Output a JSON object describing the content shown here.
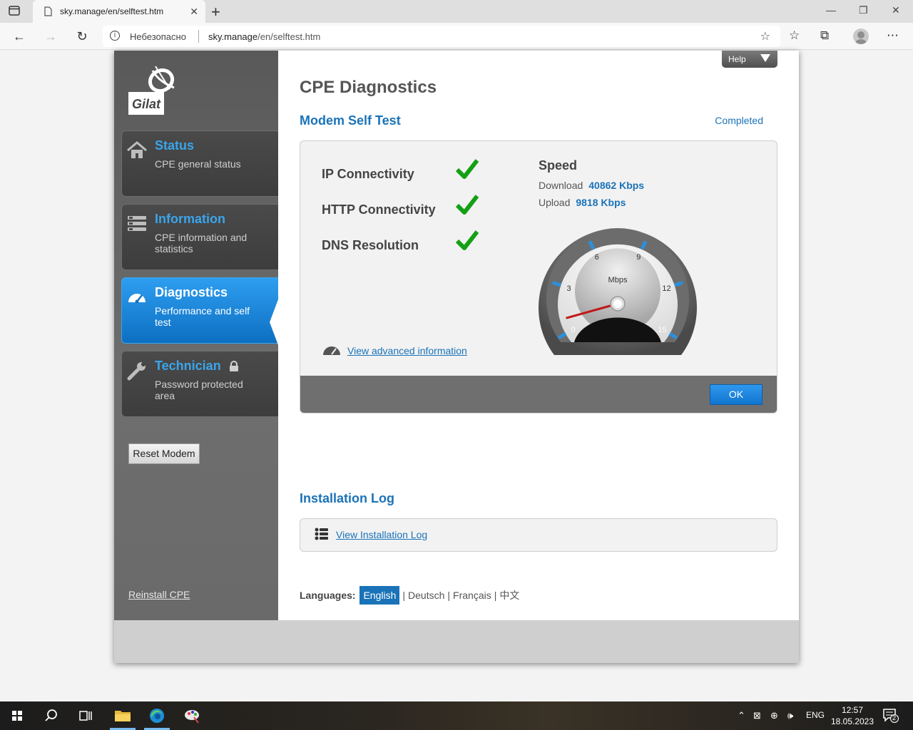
{
  "browser": {
    "tab_title": "sky.manage/en/selftest.htm",
    "insecure_label": "Небезопасно",
    "url_host": "sky.manage",
    "url_path": "/en/selftest.htm"
  },
  "logo": {
    "text": "Gilat"
  },
  "sidebar": {
    "items": [
      {
        "title": "Status",
        "sub": "CPE general status"
      },
      {
        "title": "Information",
        "sub": "CPE information and statistics"
      },
      {
        "title": "Diagnostics",
        "sub": "Performance and self test"
      },
      {
        "title": "Technician",
        "sub": "Password protected area"
      }
    ],
    "reset_label": "Reset Modem",
    "reinstall_label": "Reinstall CPE"
  },
  "help": {
    "label": "Help"
  },
  "main": {
    "title": "CPE Diagnostics",
    "selftest": {
      "title": "Modem Self Test",
      "status": "Completed",
      "tests": [
        {
          "label": "IP Connectivity"
        },
        {
          "label": "HTTP Connectivity"
        },
        {
          "label": "DNS Resolution"
        }
      ],
      "speed": {
        "title": "Speed",
        "download_label": "Download",
        "download_value": "40862 Kbps",
        "upload_label": "Upload",
        "upload_value": "9818 Kbps"
      },
      "gauge": {
        "unit": "Mbps",
        "min": 0,
        "max": 15,
        "ticks": [
          "0",
          "3",
          "6",
          "9",
          "12",
          "15"
        ],
        "needle_value": 0.9
      },
      "advanced_link": "View advanced information",
      "ok_label": "OK"
    },
    "install_log": {
      "title": "Installation Log",
      "link": "View Installation Log"
    },
    "languages": {
      "label": "Languages:",
      "current": "English",
      "others": [
        "Deutsch",
        "Français",
        "中文"
      ]
    }
  },
  "taskbar": {
    "lang": "ENG",
    "time": "12:57",
    "date": "18.05.2023",
    "notifications": "2"
  },
  "colors": {
    "accent": "#1a73b8",
    "nav_blue": "#3aa5ec",
    "check_green": "#14a014"
  }
}
